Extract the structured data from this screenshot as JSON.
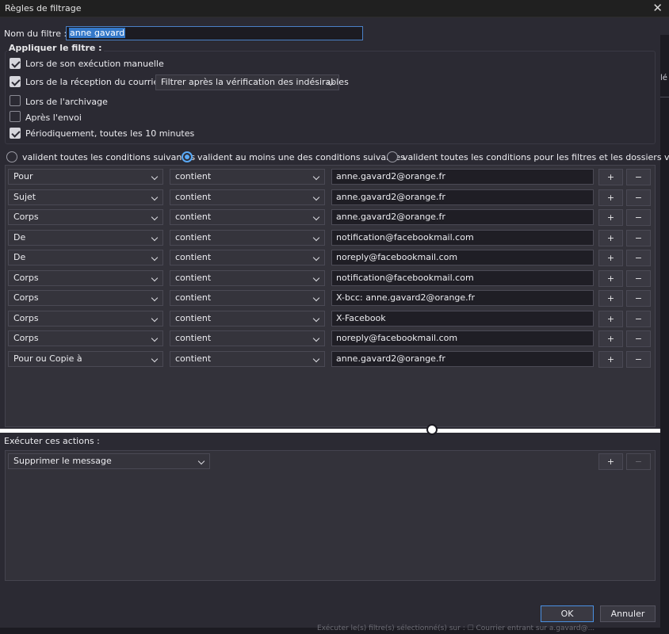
{
  "window": {
    "title": "Règles de filtrage",
    "close_glyph": "✕"
  },
  "filter_name": {
    "label": "Nom du filtre :",
    "value": "anne gavard"
  },
  "apply": {
    "legend": "Appliquer le filtre :",
    "manual": {
      "label": "Lors de son exécution manuelle",
      "checked": true
    },
    "on_receive": {
      "label": "Lors de la réception du courrier :",
      "checked": true,
      "option": "Filtrer après la vérification des indésirables"
    },
    "archiving": {
      "label": "Lors de l'archivage",
      "checked": false
    },
    "after_send": {
      "label": "Après l'envoi",
      "checked": false
    },
    "periodic": {
      "label": "Périodiquement, toutes les 10 minutes",
      "checked": true
    }
  },
  "match_mode": {
    "all": "valident toutes les conditions suivantes",
    "any": "valident au moins une des conditions suivantes",
    "all_virtual": "valident toutes les conditions pour les filtres et les dossiers virtuels",
    "selected": "any"
  },
  "rules": [
    {
      "field": "Pour",
      "op": "contient",
      "value": "anne.gavard2@orange.fr"
    },
    {
      "field": "Sujet",
      "op": "contient",
      "value": "anne.gavard2@orange.fr"
    },
    {
      "field": "Corps",
      "op": "contient",
      "value": "anne.gavard2@orange.fr"
    },
    {
      "field": "De",
      "op": "contient",
      "value": "notification@facebookmail.com"
    },
    {
      "field": "De",
      "op": "contient",
      "value": "noreply@facebookmail.com"
    },
    {
      "field": "Corps",
      "op": "contient",
      "value": "notification@facebookmail.com"
    },
    {
      "field": "Corps",
      "op": "contient",
      "value": "X-bcc: anne.gavard2@orange.fr"
    },
    {
      "field": "Corps",
      "op": "contient",
      "value": "X-Facebook"
    },
    {
      "field": "Corps",
      "op": "contient",
      "value": "noreply@facebookmail.com"
    },
    {
      "field": "Pour ou Copie à",
      "op": "contient",
      "value": "anne.gavard2@orange.fr"
    }
  ],
  "rule_buttons": {
    "add": "+",
    "remove": "−"
  },
  "actions": {
    "label": "Exécuter ces actions :",
    "action": "Supprimer le message"
  },
  "buttons": {
    "ok": "OK",
    "cancel": "Annuler"
  },
  "right_edge_glyph": "lé",
  "bottom_text": "Exécuter le(s) filtre(s) sélectionné(s) sur : ☐ Courrier entrant sur a.gavard@..."
}
